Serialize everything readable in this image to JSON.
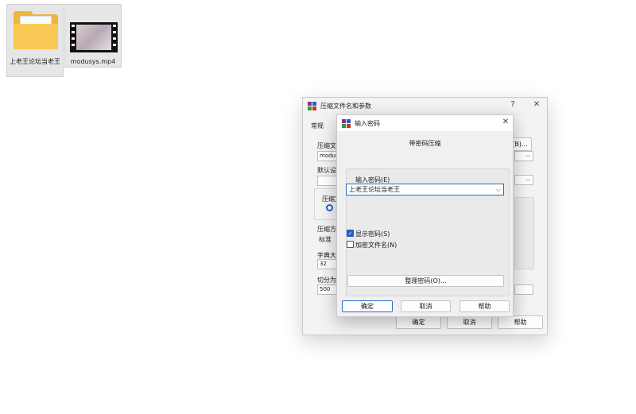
{
  "desktop": {
    "icons": [
      {
        "label": "上老王论坛当老王"
      },
      {
        "label": "modusys.mp4"
      }
    ]
  },
  "back_dialog": {
    "title": "压缩文件名和参数",
    "help_glyph": "?",
    "close_glyph": "✕",
    "tab": "常规",
    "archive_name_label": "压缩文",
    "archive_name_value": "modus",
    "browse_button": "(B)...",
    "default_profile_label": "默认设",
    "format_label": "压缩文",
    "method_label": "压缩方",
    "method_value": "标准",
    "dict_label": "字典大",
    "dict_value": "32",
    "split_label": "切分为",
    "split_value": "500",
    "ok": "确定",
    "cancel": "取消",
    "help": "帮助"
  },
  "dialog": {
    "title": "输入密码",
    "close_glyph": "✕",
    "subtitle": "带密码压缩",
    "password_label": "输入密码(E)",
    "password_value": "上老王论坛当老王",
    "show_password": {
      "label": "显示密码(S)",
      "checked": true
    },
    "encrypt_names": {
      "label": "加密文件名(N)",
      "checked": false
    },
    "organize_button": "整理密码(O)...",
    "ok": "确定",
    "cancel": "取消",
    "help": "帮助"
  }
}
